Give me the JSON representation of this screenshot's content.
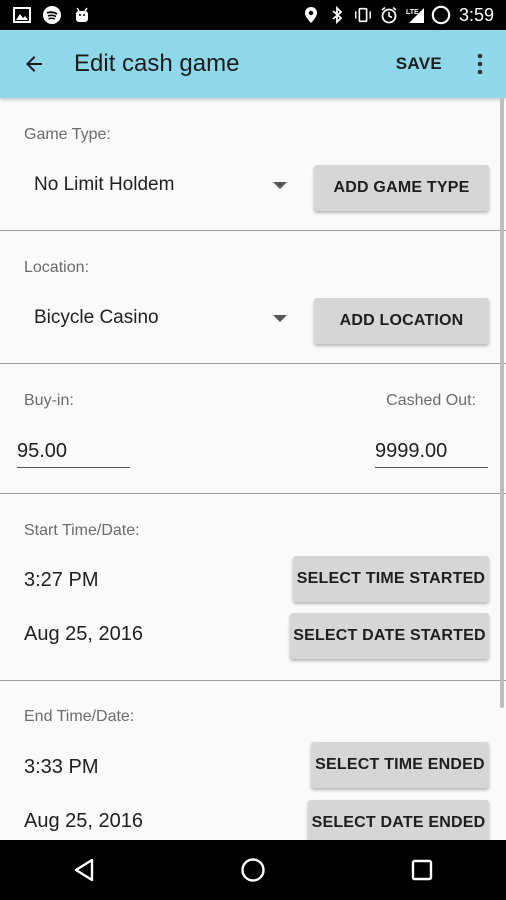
{
  "status_bar": {
    "icons_left": [
      "image-icon",
      "spotify-icon",
      "android-icon"
    ],
    "icons_right": [
      "location-icon",
      "bluetooth-icon",
      "vibrate-icon",
      "alarm-icon",
      "lte-signal-icon",
      "battery-icon"
    ],
    "time": "3:59"
  },
  "app_bar": {
    "title": "Edit cash game",
    "save_label": "SAVE",
    "color": "#8ed8ea"
  },
  "game_type": {
    "label": "Game Type:",
    "selected": "No Limit Holdem",
    "add_button": "ADD GAME TYPE"
  },
  "location": {
    "label": "Location:",
    "selected": "Bicycle Casino",
    "add_button": "ADD LOCATION"
  },
  "money": {
    "buyin_label": "Buy-in:",
    "buyin_value": "95.00",
    "cashout_label": "Cashed Out:",
    "cashout_value": "9999.00"
  },
  "start": {
    "label": "Start Time/Date:",
    "time": "3:27 PM",
    "date": "Aug 25, 2016",
    "time_button": "SELECT TIME STARTED",
    "date_button": "SELECT DATE STARTED"
  },
  "end": {
    "label": "End Time/Date:",
    "time": "3:33 PM",
    "date": "Aug 25, 2016",
    "time_button": "SELECT TIME ENDED",
    "date_button": "SELECT DATE ENDED"
  }
}
